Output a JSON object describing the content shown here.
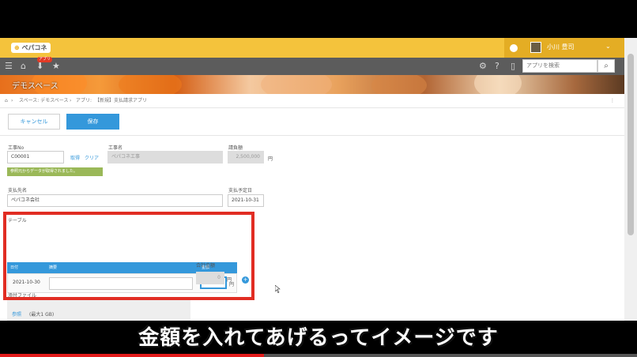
{
  "app": {
    "logo_text": "ペパコネ",
    "user_name": "小川 豊司",
    "search_placeholder": "アプリを検索",
    "space_title": "デモスペース",
    "notification_badge": "アプリ"
  },
  "breadcrumb": {
    "items": [
      "スペース: デモスペース",
      "アプリ:",
      "【新規】支払請求アプリ"
    ]
  },
  "actions": {
    "cancel_label": "キャンセル",
    "save_label": "保存"
  },
  "form": {
    "order_no_label": "工事No",
    "order_no_value": "C00001",
    "fetch_link": "取得",
    "clear_link": "クリア",
    "success_message": "参照元からデータが取得されました。",
    "order_name_label": "工事名",
    "order_name_value": "ペパコネ工事",
    "contract_amount_label": "請負額",
    "contract_amount_value": "2,500,000",
    "contract_amount_unit": "円",
    "payee_label": "支払先名",
    "payee_value": "ペパコネ会社",
    "payment_date_label": "支払予定日",
    "payment_date_value": "2021-10-31",
    "table_label": "テーブル",
    "total_label": "合計金額",
    "total_value": "0",
    "total_unit": "円",
    "attachment_label": "添付ファイル",
    "attachment_link": "参照",
    "attachment_limit": "(最大1 GB)"
  },
  "table": {
    "columns": [
      "日付",
      "摘要",
      "金額"
    ],
    "rows": [
      {
        "date": "2021-10-30",
        "description": "",
        "amount": "",
        "unit": "円"
      }
    ]
  },
  "caption": {
    "text": "金額を入れてあげるってイメージです"
  },
  "video": {
    "progress_fraction": 0.415
  }
}
